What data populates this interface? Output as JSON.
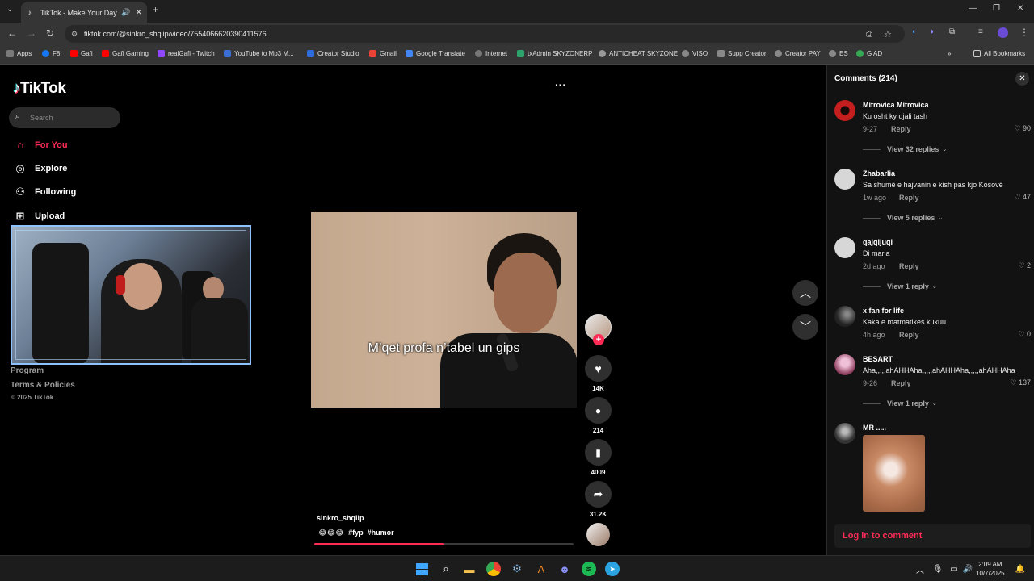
{
  "browser": {
    "tab_title": "TikTok - Make Your Day",
    "url": "tiktok.com/@sinkro_shqiip/video/7554066620390411576",
    "bookmarks": [
      "Apps",
      "F8",
      "Gafi",
      "Gafi Gaming",
      "realGafi - Twitch",
      "YouTube to Mp3 M...",
      "Creator Studio",
      "Gmail",
      "Google Translate",
      "Internet",
      "txAdmin SKYZONERP",
      "ANTICHEAT SKYZONE",
      "VISO",
      "Supp Creator",
      "Creator PAY",
      "ES",
      "G AD"
    ],
    "all_bookmarks": "All Bookmarks"
  },
  "sidebar": {
    "logo": "TikTok",
    "search_placeholder": "Search",
    "nav": [
      {
        "label": "For You",
        "icon": "home-icon",
        "active": true
      },
      {
        "label": "Explore",
        "icon": "compass-icon"
      },
      {
        "label": "Following",
        "icon": "following-icon"
      },
      {
        "label": "Upload",
        "icon": "upload-icon"
      }
    ],
    "footer": [
      "Program",
      "Terms & Policies"
    ],
    "copyright": "© 2025 TikTok"
  },
  "video": {
    "overlay_text": "M’qet profa n’tabel un gips",
    "author": "sinkro_shqiip",
    "caption_emojis": "😂😂😂",
    "hashtags": "#fyp  #humor",
    "progress": 0.5,
    "more_label": "···"
  },
  "actions": {
    "likes": "14K",
    "comments": "214",
    "saves": "4009",
    "shares": "31.2K"
  },
  "comments_panel": {
    "title": "Comments (214)",
    "login_cta": "Log in to comment",
    "items": [
      {
        "user": "Mitrovica Mitrovica",
        "text": "Ku osht ky djali tash",
        "date": "9-27",
        "reply": "Reply",
        "likes": "90",
        "view_replies": "View 32 replies"
      },
      {
        "user": "Zhabarlia",
        "text": "Sa shumë e hajvanin e kish pas kjo Kosovë",
        "date": "1w ago",
        "reply": "Reply",
        "likes": "47",
        "view_replies": "View 5 replies"
      },
      {
        "user": "qajqijuqi",
        "text": "Di maria",
        "date": "2d ago",
        "reply": "Reply",
        "likes": "2",
        "view_replies": "View 1 reply"
      },
      {
        "user": "x fan for life",
        "text": "Kaka e matmatikes kukuu",
        "date": "4h ago",
        "reply": "Reply",
        "likes": "0",
        "view_replies": ""
      },
      {
        "user": "BESART",
        "text": "Aha,,,,,ahAHHAha,,,,,ahAHHAha,,,,,ahAHHAha",
        "date": "9-26",
        "reply": "Reply",
        "likes": "137",
        "view_replies": "View 1 reply"
      },
      {
        "user": "MR .....",
        "text": "",
        "date": "",
        "reply": "",
        "likes": "",
        "view_replies": ""
      }
    ]
  },
  "taskbar": {
    "time": "2:09 AM",
    "date": "10/7/2025"
  },
  "colors": {
    "accent": "#fe2c55",
    "page_bg": "#000000",
    "panel_bg": "#121212"
  }
}
